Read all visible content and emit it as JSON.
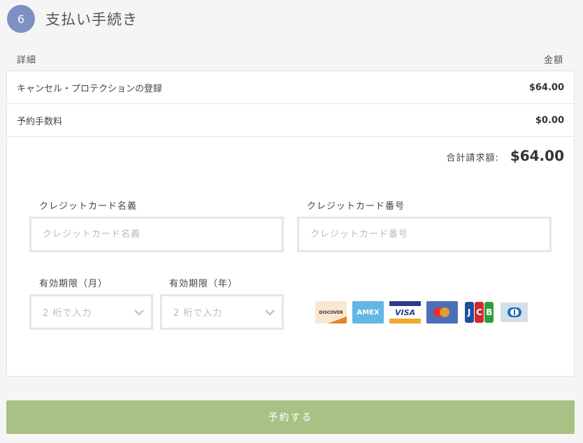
{
  "step": {
    "number": "6",
    "title": "支払い手続き"
  },
  "columns": {
    "detail": "詳細",
    "amount": "金額"
  },
  "line_items": [
    {
      "label": "キャンセル・プロテクションの登録",
      "amount": "$64.00"
    },
    {
      "label": "予約手数料",
      "amount": "$0.00"
    }
  ],
  "total": {
    "label": "合計請求額:",
    "amount": "$64.00"
  },
  "form": {
    "card_name": {
      "label": "クレジットカード名義",
      "placeholder": "クレジットカード名義"
    },
    "card_number": {
      "label": "クレジットカード番号",
      "placeholder": "クレジットカード番号"
    },
    "exp_month": {
      "label": "有効期限（月）",
      "placeholder": "2 桁で入力"
    },
    "exp_year": {
      "label": "有効期限（年）",
      "placeholder": "2 桁で入力"
    }
  },
  "card_brands": {
    "discover": "DISCOVER",
    "amex": "AMEX",
    "visa": "VISA",
    "jcb": [
      "J",
      "C",
      "B"
    ]
  },
  "submit_label": "予約する",
  "colors": {
    "step_circle": "#7e8fc4",
    "submit_button": "#a9c184",
    "border": "#e3e3e3"
  }
}
